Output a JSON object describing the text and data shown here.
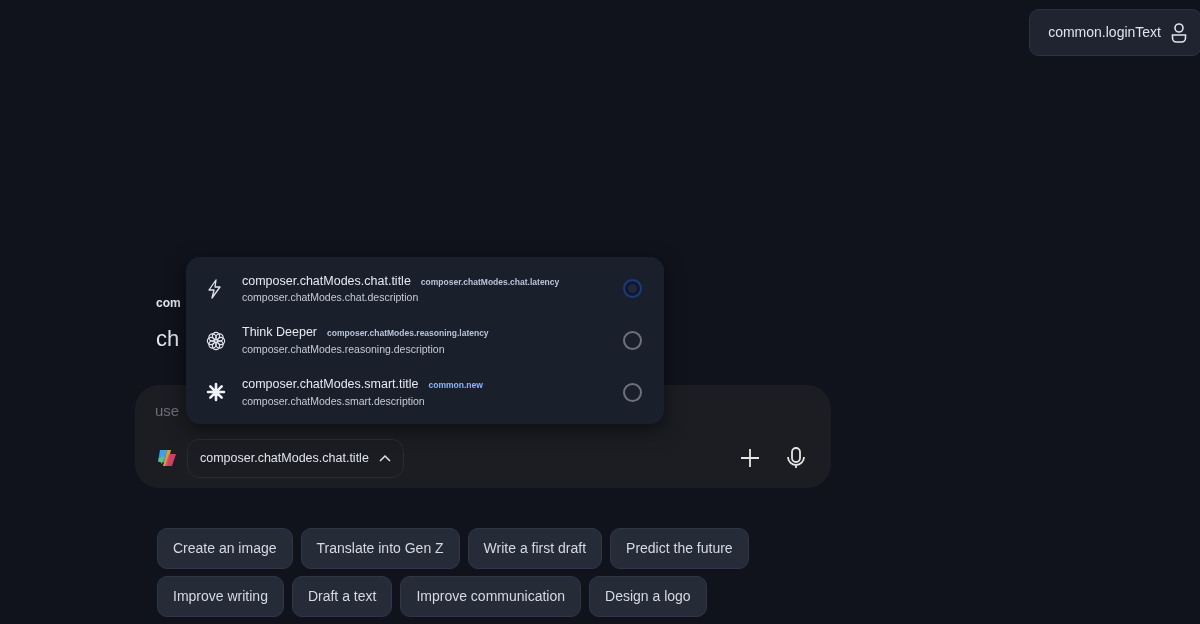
{
  "login_button": {
    "label": "common.loginText"
  },
  "greeting": {
    "subtitle": "com",
    "title": "ch"
  },
  "composer": {
    "placeholder": "use",
    "mode_button": {
      "label": "composer.chatModes.chat.title",
      "expanded": true
    }
  },
  "mode_menu": [
    {
      "kind": "bolt",
      "title": "composer.chatModes.chat.title",
      "tag": {
        "text": "composer.chatModes.chat.latency",
        "color": "#b9c3d8"
      },
      "description": "composer.chatModes.chat.description",
      "selected": true
    },
    {
      "kind": "flower",
      "title": "Think Deeper",
      "tag": {
        "text": "composer.chatModes.reasoning.latency",
        "color": "#b9c3d8"
      },
      "description": "composer.chatModes.reasoning.description",
      "selected": false
    },
    {
      "kind": "spark",
      "title": "composer.chatModes.smart.title",
      "tag": {
        "text": "common.new",
        "color": "#8fb4ff"
      },
      "description": "composer.chatModes.smart.description",
      "selected": false
    }
  ],
  "suggestions": [
    [
      "Create an image",
      "Translate into Gen Z",
      "Write a first draft",
      "Predict the future"
    ],
    [
      "Improve writing",
      "Draft a text",
      "Improve communication",
      "Design a logo"
    ]
  ]
}
